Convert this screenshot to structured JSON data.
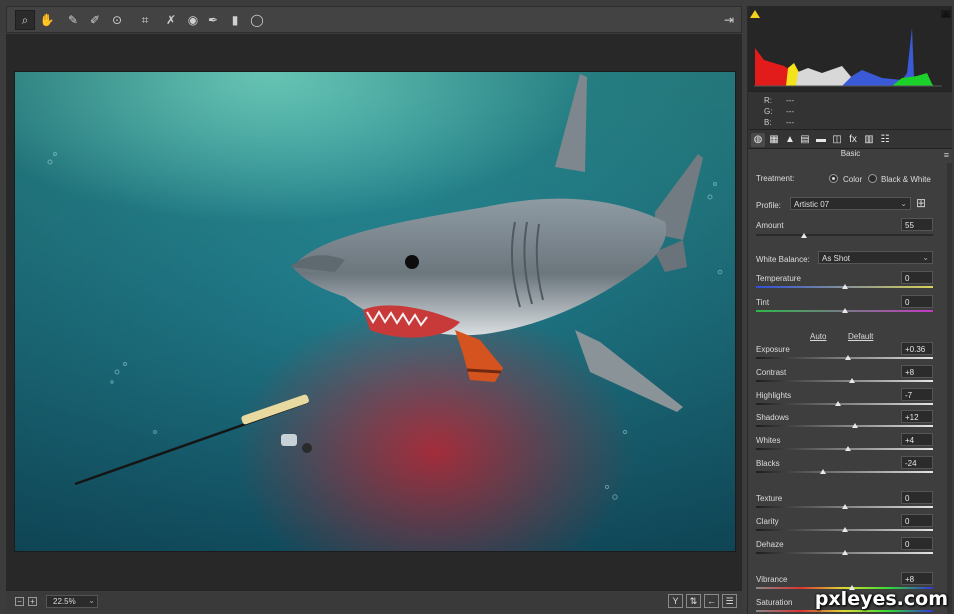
{
  "toolbar": {
    "tools": [
      {
        "name": "zoom-tool",
        "icon": "magnifier-icon",
        "glyph": "⌕",
        "active": true
      },
      {
        "name": "hand-tool",
        "icon": "hand-icon",
        "glyph": "✋"
      },
      {
        "name": "white-balance-tool",
        "icon": "eyedropper-icon",
        "glyph": "✎"
      },
      {
        "name": "color-sampler-tool",
        "icon": "sampler-icon",
        "glyph": "✐"
      },
      {
        "name": "targeted-adjustment-tool",
        "icon": "target-icon",
        "glyph": "⊙"
      },
      {
        "name": "crop-tool",
        "icon": "crop-icon",
        "glyph": "⌗"
      },
      {
        "name": "spot-removal-tool",
        "icon": "spot-removal-icon",
        "glyph": "✗"
      },
      {
        "name": "red-eye-tool",
        "icon": "red-eye-icon",
        "glyph": "◉"
      },
      {
        "name": "adjustment-brush-tool",
        "icon": "brush-icon",
        "glyph": "✒"
      },
      {
        "name": "graduated-filter-tool",
        "icon": "gradient-icon",
        "glyph": "▮"
      },
      {
        "name": "radial-filter-tool",
        "icon": "ellipse-icon",
        "glyph": "◯"
      }
    ],
    "open_glyph": "⇥"
  },
  "status_bar": {
    "zoom_out": "−",
    "zoom_in": "+",
    "zoom_value": "22.5%",
    "zoom_chevron": "⌄",
    "view_buttons": [
      {
        "name": "before-after-toggle-button",
        "icon": "y-compare-icon",
        "glyph": "Y"
      },
      {
        "name": "swap-settings-button",
        "icon": "swap-icon",
        "glyph": "⇅"
      },
      {
        "name": "copy-settings-button",
        "icon": "arrow-left-icon",
        "glyph": "←"
      },
      {
        "name": "preview-preferences-button",
        "icon": "sliders-icon",
        "glyph": "☰"
      }
    ]
  },
  "readout": {
    "r_label": "R:",
    "r_value": "---",
    "g_label": "G:",
    "g_value": "---",
    "b_label": "B:",
    "b_value": "---"
  },
  "panel_tabs": [
    {
      "name": "tab-basic",
      "icon": "aperture-icon",
      "glyph": "◍",
      "active": true
    },
    {
      "name": "tab-tone-curve",
      "icon": "curve-grid-icon",
      "glyph": "▦"
    },
    {
      "name": "tab-detail",
      "icon": "mountain-icon",
      "glyph": "▲"
    },
    {
      "name": "tab-hsl",
      "icon": "hsl-icon",
      "glyph": "▤"
    },
    {
      "name": "tab-split-toning",
      "icon": "split-tone-icon",
      "glyph": "▬"
    },
    {
      "name": "tab-lens",
      "icon": "lens-icon",
      "glyph": "◫"
    },
    {
      "name": "tab-effects",
      "icon": "fx-icon",
      "glyph": "fx"
    },
    {
      "name": "tab-calibration",
      "icon": "filmstrip-icon",
      "glyph": "▥"
    },
    {
      "name": "tab-presets",
      "icon": "presets-icon",
      "glyph": "☷"
    }
  ],
  "basic": {
    "section_title": "Basic",
    "menu_glyph": "≡",
    "treatment_label": "Treatment:",
    "color_label": "Color",
    "bw_label": "Black & White",
    "treatment_selected": "Color",
    "profile_label": "Profile:",
    "profile_value": "Artistic 07",
    "amount_label": "Amount",
    "amount_value": "55",
    "wb_label": "White Balance:",
    "wb_value": "As Shot",
    "auto_label": "Auto",
    "default_label": "Default",
    "sliders": [
      {
        "key": "temperature",
        "label": "Temperature",
        "value": "0",
        "position": 0.5
      },
      {
        "key": "tint",
        "label": "Tint",
        "value": "0",
        "position": 0.5
      },
      {
        "key": "exposure",
        "label": "Exposure",
        "value": "+0.36",
        "position": 0.518
      },
      {
        "key": "contrast",
        "label": "Contrast",
        "value": "+8",
        "position": 0.54
      },
      {
        "key": "highlights",
        "label": "Highlights",
        "value": "-7",
        "position": 0.465
      },
      {
        "key": "shadows",
        "label": "Shadows",
        "value": "+12",
        "position": 0.56
      },
      {
        "key": "whites",
        "label": "Whites",
        "value": "+4",
        "position": 0.52
      },
      {
        "key": "blacks",
        "label": "Blacks",
        "value": "-24",
        "position": 0.38
      },
      {
        "key": "texture",
        "label": "Texture",
        "value": "0",
        "position": 0.5
      },
      {
        "key": "clarity",
        "label": "Clarity",
        "value": "0",
        "position": 0.5
      },
      {
        "key": "dehaze",
        "label": "Dehaze",
        "value": "0",
        "position": 0.5
      },
      {
        "key": "vibrance",
        "label": "Vibrance",
        "value": "+8",
        "position": 0.54
      },
      {
        "key": "saturation",
        "label": "Saturation",
        "value": "",
        "position": 0.5
      }
    ]
  },
  "watermark": "pxleyes.com"
}
